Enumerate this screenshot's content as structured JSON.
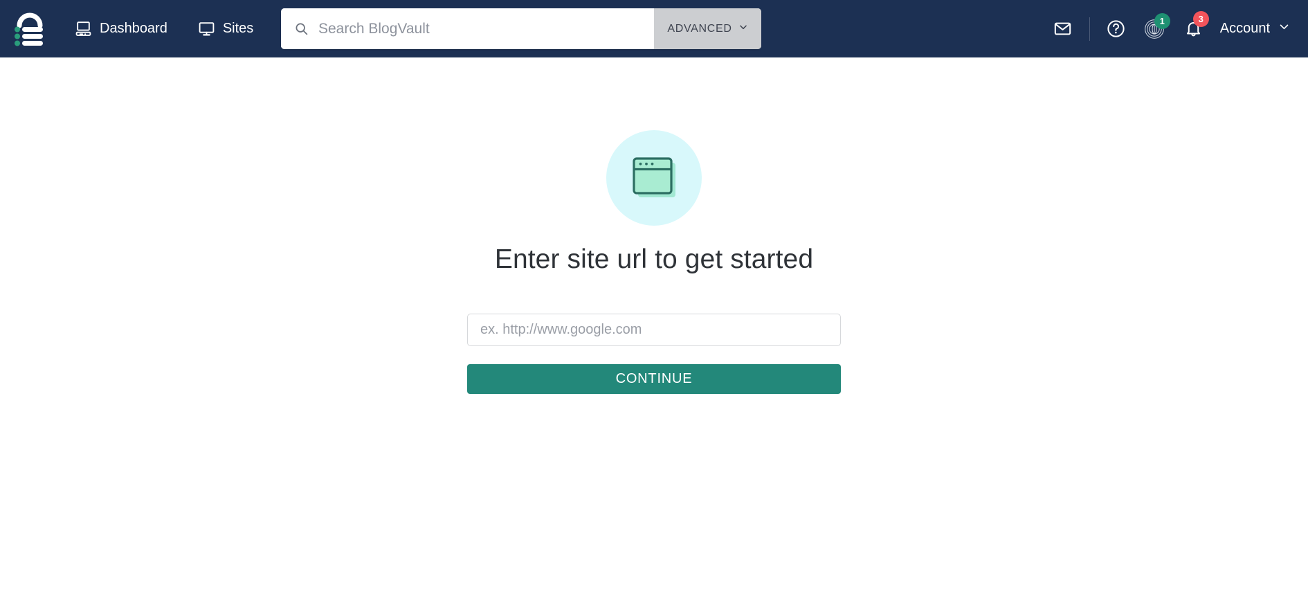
{
  "header": {
    "logo": {
      "icon": "blogvault-padlock-logo",
      "alt": "BlogVault"
    },
    "nav": [
      {
        "label": "Dashboard",
        "icon": "desktop-computer-icon"
      },
      {
        "label": "Sites",
        "icon": "monitor-icon"
      }
    ],
    "search": {
      "icon": "search-icon",
      "placeholder": "Search BlogVault",
      "value": "",
      "advanced_label": "ADVANCED",
      "advanced_caret": "chevron-down-icon"
    },
    "right": {
      "mail": {
        "icon": "envelope-icon"
      },
      "help": {
        "icon": "question-circle-icon"
      },
      "activity": {
        "icon": "radar-circles-icon",
        "badge": "1",
        "badge_color": "#1e9172"
      },
      "notifications": {
        "icon": "bell-icon",
        "badge": "3",
        "badge_color": "#f2545b"
      },
      "account": {
        "label": "Account",
        "caret": "chevron-down-icon"
      }
    }
  },
  "main": {
    "illustration": {
      "icon": "browser-window-icon",
      "circle_color": "#d8f8fb",
      "window_fill": "#8fe3c4",
      "window_stroke": "#2c6e62"
    },
    "title": "Enter site url to get started",
    "url_field": {
      "placeholder": "ex. http://www.google.com",
      "value": ""
    },
    "continue_label": "CONTINUE"
  },
  "colors": {
    "header_bg": "#1c3053",
    "accent_teal": "#23887a",
    "page_bg": "#ffffff",
    "advanced_bg": "#ccced1"
  }
}
